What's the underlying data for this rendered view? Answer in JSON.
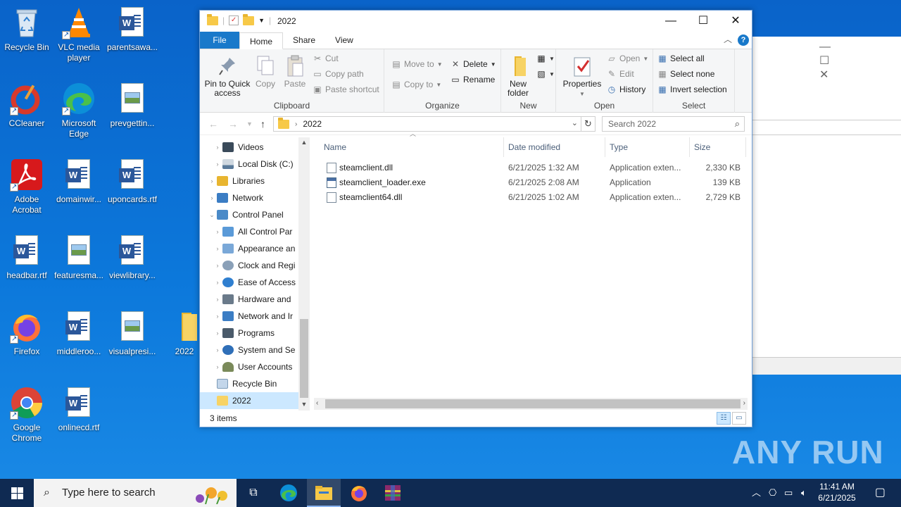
{
  "desktop": {
    "icons": [
      {
        "label": "Recycle Bin"
      },
      {
        "label": "VLC media player"
      },
      {
        "label": "parentsawa..."
      },
      {
        "label": "CCleaner"
      },
      {
        "label": "Microsoft Edge"
      },
      {
        "label": "prevgettin..."
      },
      {
        "label": "Adobe Acrobat"
      },
      {
        "label": "domainwir..."
      },
      {
        "label": "uponcards.rtf"
      },
      {
        "label": "headbar.rtf"
      },
      {
        "label": "featuresma..."
      },
      {
        "label": "viewlibrary..."
      },
      {
        "label": "Firefox"
      },
      {
        "label": "middleroo..."
      },
      {
        "label": "visualpresi..."
      },
      {
        "label": "2022"
      },
      {
        "label": "Google Chrome"
      },
      {
        "label": "onlinecd.rtf"
      }
    ],
    "watermark": "ANY RUN"
  },
  "explorer": {
    "title": "2022",
    "window_buttons": {
      "minimize": "—",
      "maximize": "☐",
      "close": "✕"
    },
    "tabs": [
      "File",
      "Home",
      "Share",
      "View"
    ],
    "active_tab": "Home",
    "help": "?",
    "ribbon": {
      "clipboard": {
        "name": "Clipboard",
        "pin": "Pin to Quick access",
        "copy": "Copy",
        "paste": "Paste",
        "cut": "Cut",
        "copy_path": "Copy path",
        "paste_shortcut": "Paste shortcut"
      },
      "organize": {
        "name": "Organize",
        "move_to": "Move to",
        "copy_to": "Copy to",
        "delete": "Delete",
        "rename": "Rename"
      },
      "new": {
        "name": "New",
        "new_folder": "New folder"
      },
      "open": {
        "name": "Open",
        "properties": "Properties",
        "open": "Open",
        "edit": "Edit",
        "history": "History"
      },
      "select": {
        "name": "Select",
        "select_all": "Select all",
        "select_none": "Select none",
        "invert": "Invert selection"
      }
    },
    "address": {
      "path": "2022",
      "search_placeholder": "Search 2022"
    },
    "nav_pane": [
      {
        "label": "Videos",
        "level": 2
      },
      {
        "label": "Local Disk (C:)",
        "level": 2
      },
      {
        "label": "Libraries",
        "level": 1
      },
      {
        "label": "Network",
        "level": 1
      },
      {
        "label": "Control Panel",
        "level": 1,
        "expanded": true
      },
      {
        "label": "All Control Par",
        "level": 2
      },
      {
        "label": "Appearance an",
        "level": 2
      },
      {
        "label": "Clock and Regi",
        "level": 2
      },
      {
        "label": "Ease of Access",
        "level": 2
      },
      {
        "label": "Hardware and",
        "level": 2
      },
      {
        "label": "Network and Ir",
        "level": 2
      },
      {
        "label": "Programs",
        "level": 2
      },
      {
        "label": "System and Se",
        "level": 2
      },
      {
        "label": "User Accounts",
        "level": 2
      },
      {
        "label": "Recycle Bin",
        "level": 1
      },
      {
        "label": "2022",
        "level": 1,
        "selected": true
      }
    ],
    "columns": [
      "Name",
      "Date modified",
      "Type",
      "Size"
    ],
    "files": [
      {
        "name": "steamclient.dll",
        "date": "6/21/2025 1:32 AM",
        "type": "Application exten...",
        "size": "2,330 KB"
      },
      {
        "name": "steamclient_loader.exe",
        "date": "6/21/2025 2:08 AM",
        "type": "Application",
        "size": "139 KB"
      },
      {
        "name": "steamclient64.dll",
        "date": "6/21/2025 1:02 AM",
        "type": "Application exten...",
        "size": "2,729 KB"
      }
    ],
    "status": "3 items"
  },
  "taskbar": {
    "search_placeholder": "Type here to search",
    "time": "11:41 AM",
    "date": "6/21/2025"
  }
}
